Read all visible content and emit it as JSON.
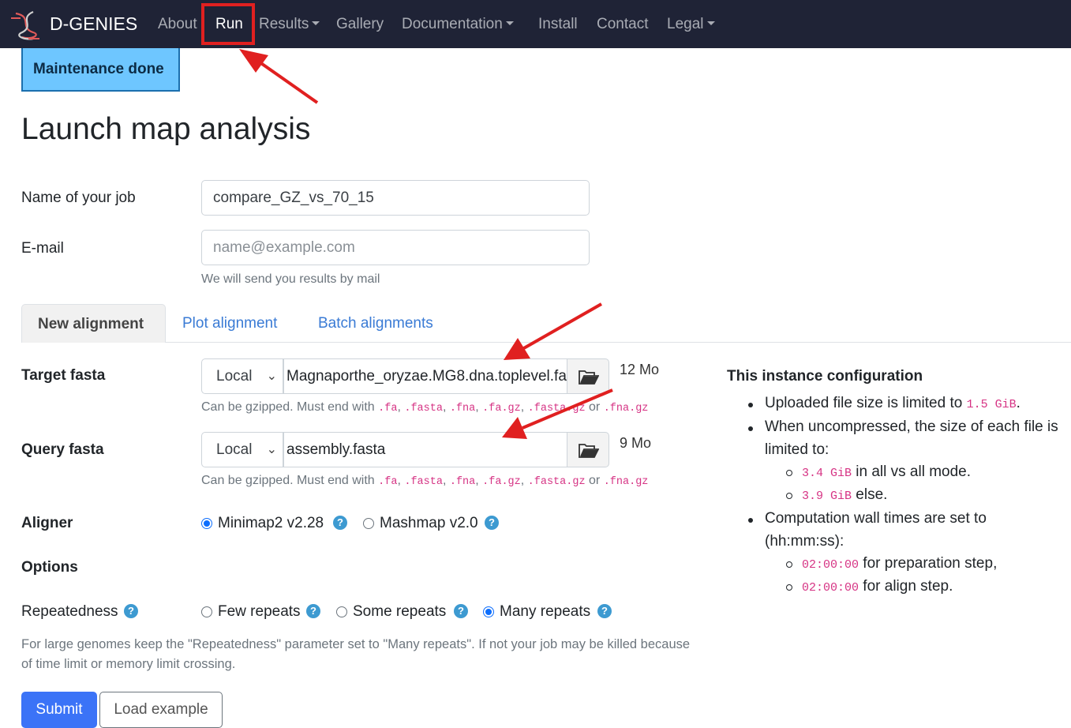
{
  "nav": {
    "brand": "D-GENIES",
    "items": [
      {
        "label": "About"
      },
      {
        "label": "Run"
      },
      {
        "label": "Results"
      },
      {
        "label": "Gallery"
      },
      {
        "label": "Documentation"
      },
      {
        "label": "Install"
      },
      {
        "label": "Contact"
      },
      {
        "label": "Legal"
      }
    ]
  },
  "banner": {
    "text": "Maintenance done"
  },
  "page_title": "Launch map analysis",
  "form": {
    "job_label": "Name of your job",
    "job_value": "compare_GZ_vs_70_15",
    "email_label": "E-mail",
    "email_placeholder": "name@example.com",
    "email_help": "We will send you results by mail"
  },
  "tabs": [
    {
      "label": "New alignment"
    },
    {
      "label": "Plot alignment"
    },
    {
      "label": "Batch alignments"
    }
  ],
  "target": {
    "label": "Target fasta",
    "source": "Local",
    "file": "Magnaporthe_oryzae.MG8.dna.toplevel.fa",
    "size": "12 Mo"
  },
  "query": {
    "label": "Query fasta",
    "source": "Local",
    "file": "assembly.fasta",
    "size": "9 Mo"
  },
  "file_help": {
    "prefix": "Can be gzipped. Must end with",
    "ext1": ".fa",
    "ext2": ".fasta",
    "ext3": ".fna",
    "ext4": ".fa.gz",
    "ext5": ".fasta.gz",
    "or": "or",
    "ext6": ".fna.gz"
  },
  "aligner": {
    "label": "Aligner",
    "opt1": "Minimap2 v2.28",
    "opt2": "Mashmap v2.0"
  },
  "options_label": "Options",
  "repeatedness": {
    "label": "Repeatedness",
    "opt1": "Few repeats",
    "opt2": "Some repeats",
    "opt3": "Many repeats"
  },
  "note": "For large genomes keep the \"Repeatedness\" parameter set to \"Many repeats\". If not your job may be killed because of time limit or memory limit crossing.",
  "buttons": {
    "submit": "Submit",
    "load_example": "Load example"
  },
  "config": {
    "title": "This instance configuration",
    "upload_prefix": "Uploaded file size is limited to",
    "upload_value": "1.5 GiB",
    "upload_suffix": ".",
    "uncompressed_line1": "When uncompressed, the size of each file is",
    "uncompressed_line2": "limited to:",
    "allvsall_value": "3.4 GiB",
    "allvsall_suffix": "in all vs all mode.",
    "else_value": "3.9 GiB",
    "else_suffix": "else.",
    "wall_line1": "Computation wall times are set to",
    "wall_line2": "(hh:mm:ss):",
    "prep_value": "02:00:00",
    "prep_suffix": "for preparation step,",
    "align_value": "02:00:00",
    "align_suffix": "for align step."
  },
  "colors": {
    "navbar": "#1f2336",
    "banner": "#6ec6ff",
    "primary": "#3b73f7",
    "annotation": "#e02020",
    "code": "#d63384"
  }
}
